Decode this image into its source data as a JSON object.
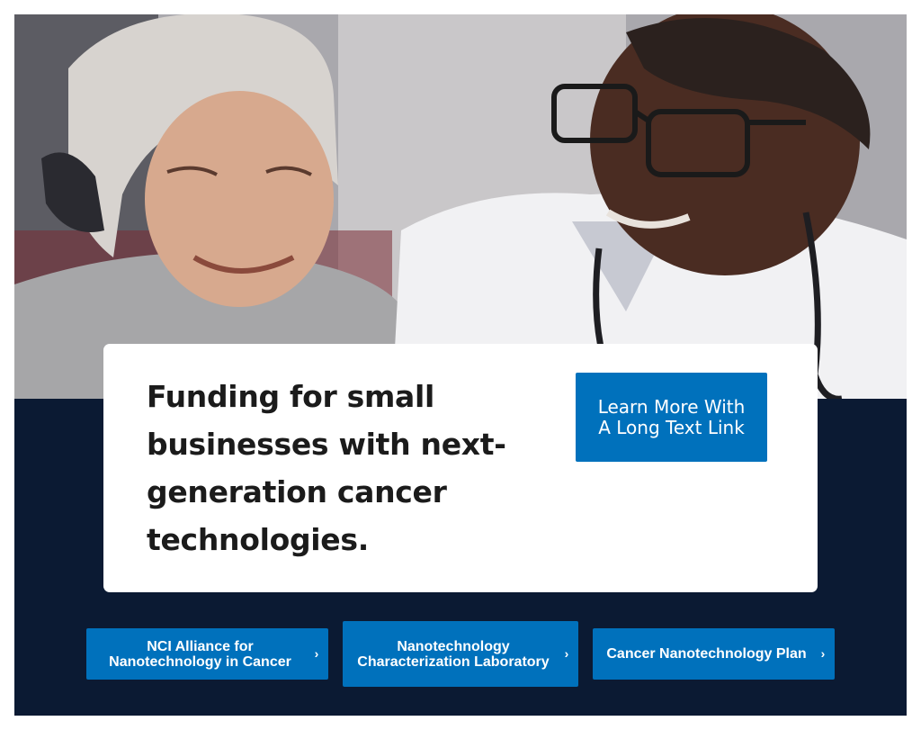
{
  "hero": {
    "image_alt": "",
    "title": "Funding for small businesses with next-generation cancer technologies.",
    "cta_label": "Learn More With A Long Text Link"
  },
  "quick_links": [
    {
      "label": "NCI Alliance for Nanotechnology in Cancer",
      "icon": "chevron-right-icon"
    },
    {
      "label": "Nanotechnology Characterization Laboratory",
      "icon": "chevron-right-icon"
    },
    {
      "label": "Cancer Nanotechnology Plan",
      "icon": "chevron-right-icon"
    }
  ],
  "colors": {
    "navy_background": "#0b1a33",
    "link_blue": "#0071bc",
    "card_white": "#ffffff",
    "title_text": "#1b1b1b"
  }
}
